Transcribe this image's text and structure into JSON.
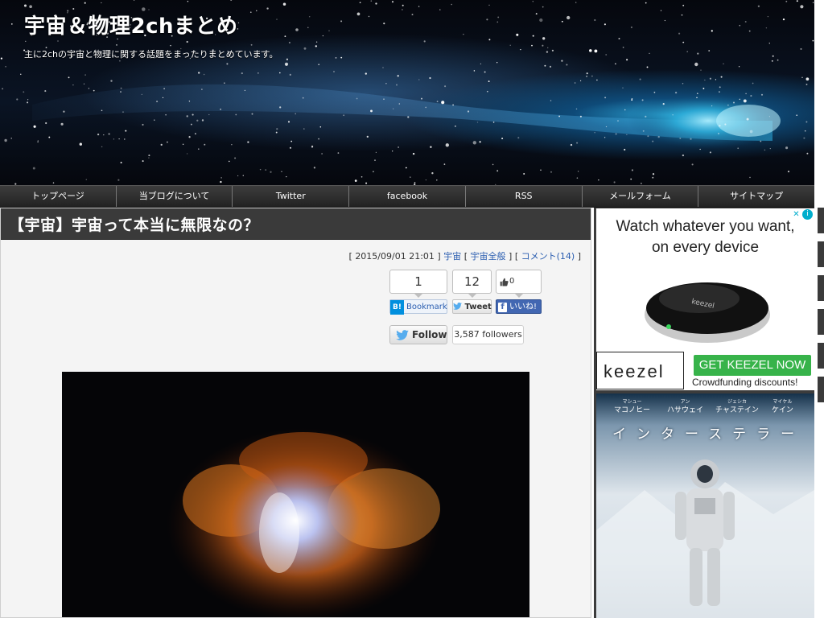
{
  "site": {
    "title": "宇宙＆物理2chまとめ",
    "description": "主に2chの宇宙と物理に関する話題をまったりまとめています。"
  },
  "nav": {
    "items": [
      {
        "label": "トップページ"
      },
      {
        "label": "当ブログについて"
      },
      {
        "label": "Twitter"
      },
      {
        "label": "facebook"
      },
      {
        "label": "RSS"
      },
      {
        "label": "メールフォーム"
      },
      {
        "label": "サイトマップ"
      }
    ]
  },
  "article": {
    "title": "【宇宙】宇宙って本当に無限なの？",
    "meta": {
      "open_bracket": "[",
      "datetime": "2015/09/01 21:01",
      "close_bracket": "]",
      "category": "宇宙",
      "subcategory": "宇宙全般",
      "comments": "コメント(14)"
    },
    "share": {
      "hatena_count": "1",
      "hatena_label": "Bookmark",
      "hatena_badge": "B!",
      "tweet_count": "12",
      "tweet_label": "Tweet",
      "fb_count": "0",
      "fb_label": "いいね!",
      "fb_badge": "f"
    },
    "twitter_follow": {
      "label": "Follow",
      "followers": "3,587 followers"
    },
    "image_alt_colors": [
      "#050507",
      "#e07a1f",
      "#c9d4ff"
    ]
  },
  "ads": {
    "keezel": {
      "headline_line1": "Watch whatever you want,",
      "headline_line2": "on every device",
      "info_icon": "i",
      "close_icon": "✕",
      "logo": "keezel",
      "device_brand": "keezel",
      "cta": "GET KEEZEL NOW",
      "subtext": "Crowdfunding discounts!",
      "cta_color": "#37b34a"
    },
    "interstellar": {
      "cast": [
        {
          "katakana": "マシュー",
          "name": "マコノヒー"
        },
        {
          "katakana": "アン",
          "name": "ハサウェイ"
        },
        {
          "katakana": "ジェシカ",
          "name": "チャステイン"
        },
        {
          "katakana": "マイケル",
          "name": "ケイン"
        }
      ],
      "title": "インターステラー"
    }
  },
  "colors": {
    "nav_bg": "#2b2b2b",
    "title_bar": "#3a3a3a",
    "link": "#2a5db0",
    "twitter_blue": "#55acee",
    "facebook_blue": "#3b5998",
    "hatena_blue": "#008fde"
  }
}
